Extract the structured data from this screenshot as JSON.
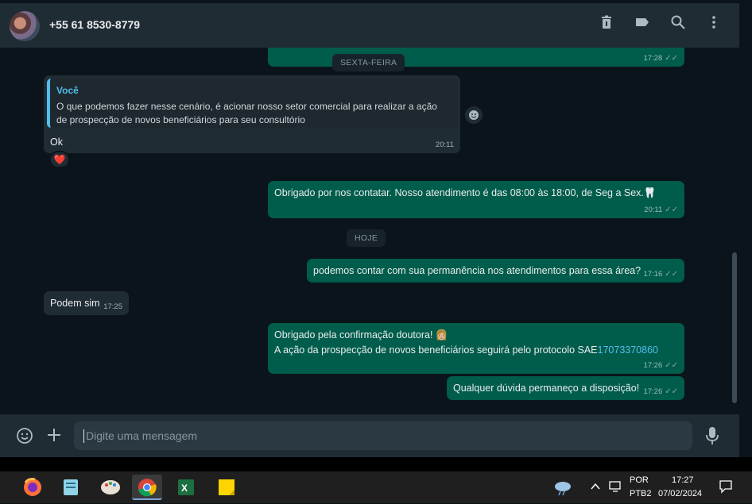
{
  "header": {
    "contact_name": "+55 61 8530-8779",
    "icons": [
      "delete-icon",
      "label-icon",
      "search-icon",
      "menu-dots-icon"
    ]
  },
  "messages": {
    "m0_time": "17:28",
    "day1": "SEXTA-FEIRA",
    "m1_quote_author": "Você",
    "m1_quote_text": "O que podemos fazer nesse cenário, é acionar nosso setor comercial para realizar a ação de prospecção de novos beneficiários para seu consultório",
    "m1_text": "Ok",
    "m1_time": "20:11",
    "m1_reaction": "❤️",
    "m2_text": "Obrigado por nos contatar. Nosso atendimento é das 08:00 às 18:00, de Seg a Sex.🦷",
    "m2_time": "20:11",
    "day2": "HOJE",
    "m3_text": "podemos contar com sua permanência nos atendimentos para essa área?",
    "m3_time": "17:16",
    "m4_text": "Podem sim",
    "m4_time": "17:25",
    "m5_line1": "Obrigado pela confirmação doutora! 👩🏼",
    "m5_line2_prefix": "A ação da prospecção de novos beneficiários seguirá pelo protocolo SAE",
    "m5_line2_link": "17073370860",
    "m5_time": "17:26",
    "m6_text": "Qualquer dúvida permaneço a disposição!",
    "m6_time": "17:26"
  },
  "composer": {
    "placeholder": "Digite uma mensagem",
    "icons": [
      "emoji-icon",
      "plus-icon",
      "microphone-icon"
    ]
  },
  "taskbar": {
    "apps": [
      "firefox-icon",
      "notepad-icon",
      "paint-icon",
      "chrome-icon",
      "excel-icon",
      "sticky-notes-icon"
    ],
    "lang_top": "POR",
    "lang_bottom": "PTB2",
    "time": "17:27",
    "date": "07/02/2024"
  },
  "colors": {
    "outgoing": "#005c4b",
    "incoming": "#202c33",
    "background": "#0b141a",
    "link": "#53bdeb"
  }
}
